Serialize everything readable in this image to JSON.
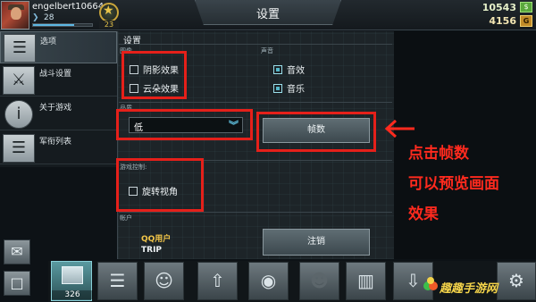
{
  "player": {
    "name": "engelbert10664",
    "rank": "28",
    "level": "23",
    "xp_fraction": 0.7
  },
  "currency": {
    "money": "10543",
    "money_icon": "$",
    "gold": "4156",
    "gold_icon": "G"
  },
  "header": {
    "title": "设置"
  },
  "menu": {
    "items": [
      {
        "label": "选项",
        "icon": "sliders-icon"
      },
      {
        "label": "战斗设置",
        "icon": "crossed-swords-icon"
      },
      {
        "label": "关于游戏",
        "icon": "info-icon"
      },
      {
        "label": "军衔列表",
        "icon": "rank-chevrons-icon"
      }
    ]
  },
  "settings": {
    "heading": "设置",
    "image_section": "图像",
    "sound_section": "声音",
    "quality_section": "品质",
    "control_section": "游戏控制:",
    "account_section": "帐户",
    "shadow_label": "阴影效果",
    "cloud_label": "云朵效果",
    "sfx_label": "音效",
    "music_label": "音乐",
    "quality_value": "低",
    "fps_button": "帧数",
    "rotate_label": "旋转视角",
    "account_type": "QQ用户",
    "account_name": "TRIP",
    "logout_button": "注销",
    "shadow_checked": false,
    "cloud_checked": false,
    "sfx_checked": true,
    "music_checked": true,
    "rotate_checked": false
  },
  "annotation": {
    "line1": "点击帧数",
    "line2": "可以预览画面",
    "line3": "效果",
    "color": "#ff2a1e"
  },
  "bottom": {
    "ammo_count": "326",
    "watermark": "趣趣手游网"
  },
  "colors": {
    "accent": "#54b7c9",
    "highlight": "#e5201a"
  }
}
